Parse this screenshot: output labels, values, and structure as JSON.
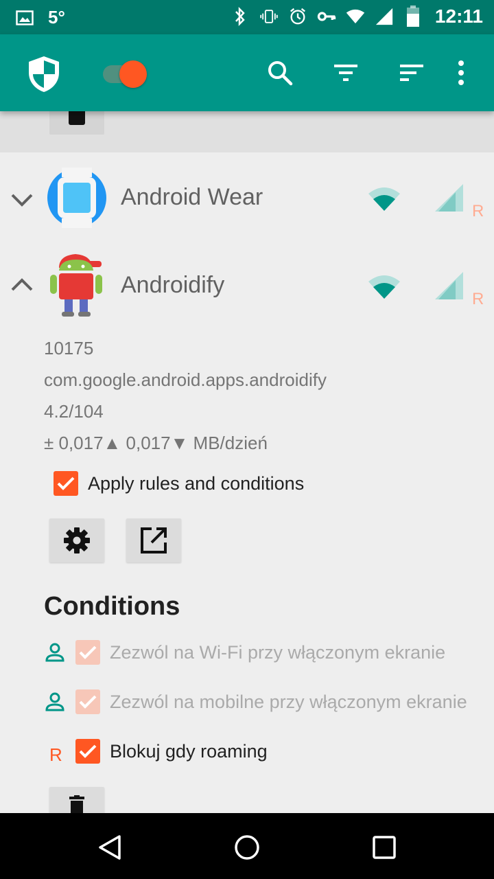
{
  "status_bar": {
    "temperature": "5°",
    "time": "12:11",
    "icons": [
      "image-notification-icon",
      "bluetooth-icon",
      "vibrate-icon",
      "alarm-icon",
      "vpn-key-icon",
      "wifi-icon",
      "cell-signal-icon",
      "battery-icon"
    ]
  },
  "app_bar": {
    "logo_icon": "shield-icon",
    "enabled_toggle": true,
    "actions": [
      "search-icon",
      "filter-icon",
      "sort-icon",
      "more-vert-icon"
    ]
  },
  "apps": [
    {
      "name": "Android Wear",
      "expanded": false,
      "wifi_allowed": true,
      "mobile_allowed": true,
      "roaming_mark": "R"
    },
    {
      "name": "Androidify",
      "expanded": true,
      "wifi_allowed": true,
      "mobile_allowed": true,
      "roaming_mark": "R",
      "uid": "10175",
      "package": "com.google.android.apps.androidify",
      "version": "4.2/104",
      "traffic": "± 0,017▲ 0,017▼ MB/dzień",
      "apply_rules_label": "Apply rules and conditions",
      "apply_rules_checked": true
    }
  ],
  "conditions": {
    "title": "Conditions",
    "items": [
      {
        "label": "Zezwól na Wi-Fi przy włączonym ekranie",
        "checked": true,
        "enabled": false,
        "indicator": "person-icon"
      },
      {
        "label": "Zezwól na mobilne przy włączonym ekranie",
        "checked": true,
        "enabled": false,
        "indicator": "person-icon"
      },
      {
        "label": "Blokuj gdy roaming",
        "checked": true,
        "enabled": true,
        "indicator": "R"
      }
    ]
  },
  "colors": {
    "primary": "#009688",
    "primary_dark": "#00796b",
    "accent": "#ff5722",
    "roaming_indicator": "#ffab91"
  }
}
